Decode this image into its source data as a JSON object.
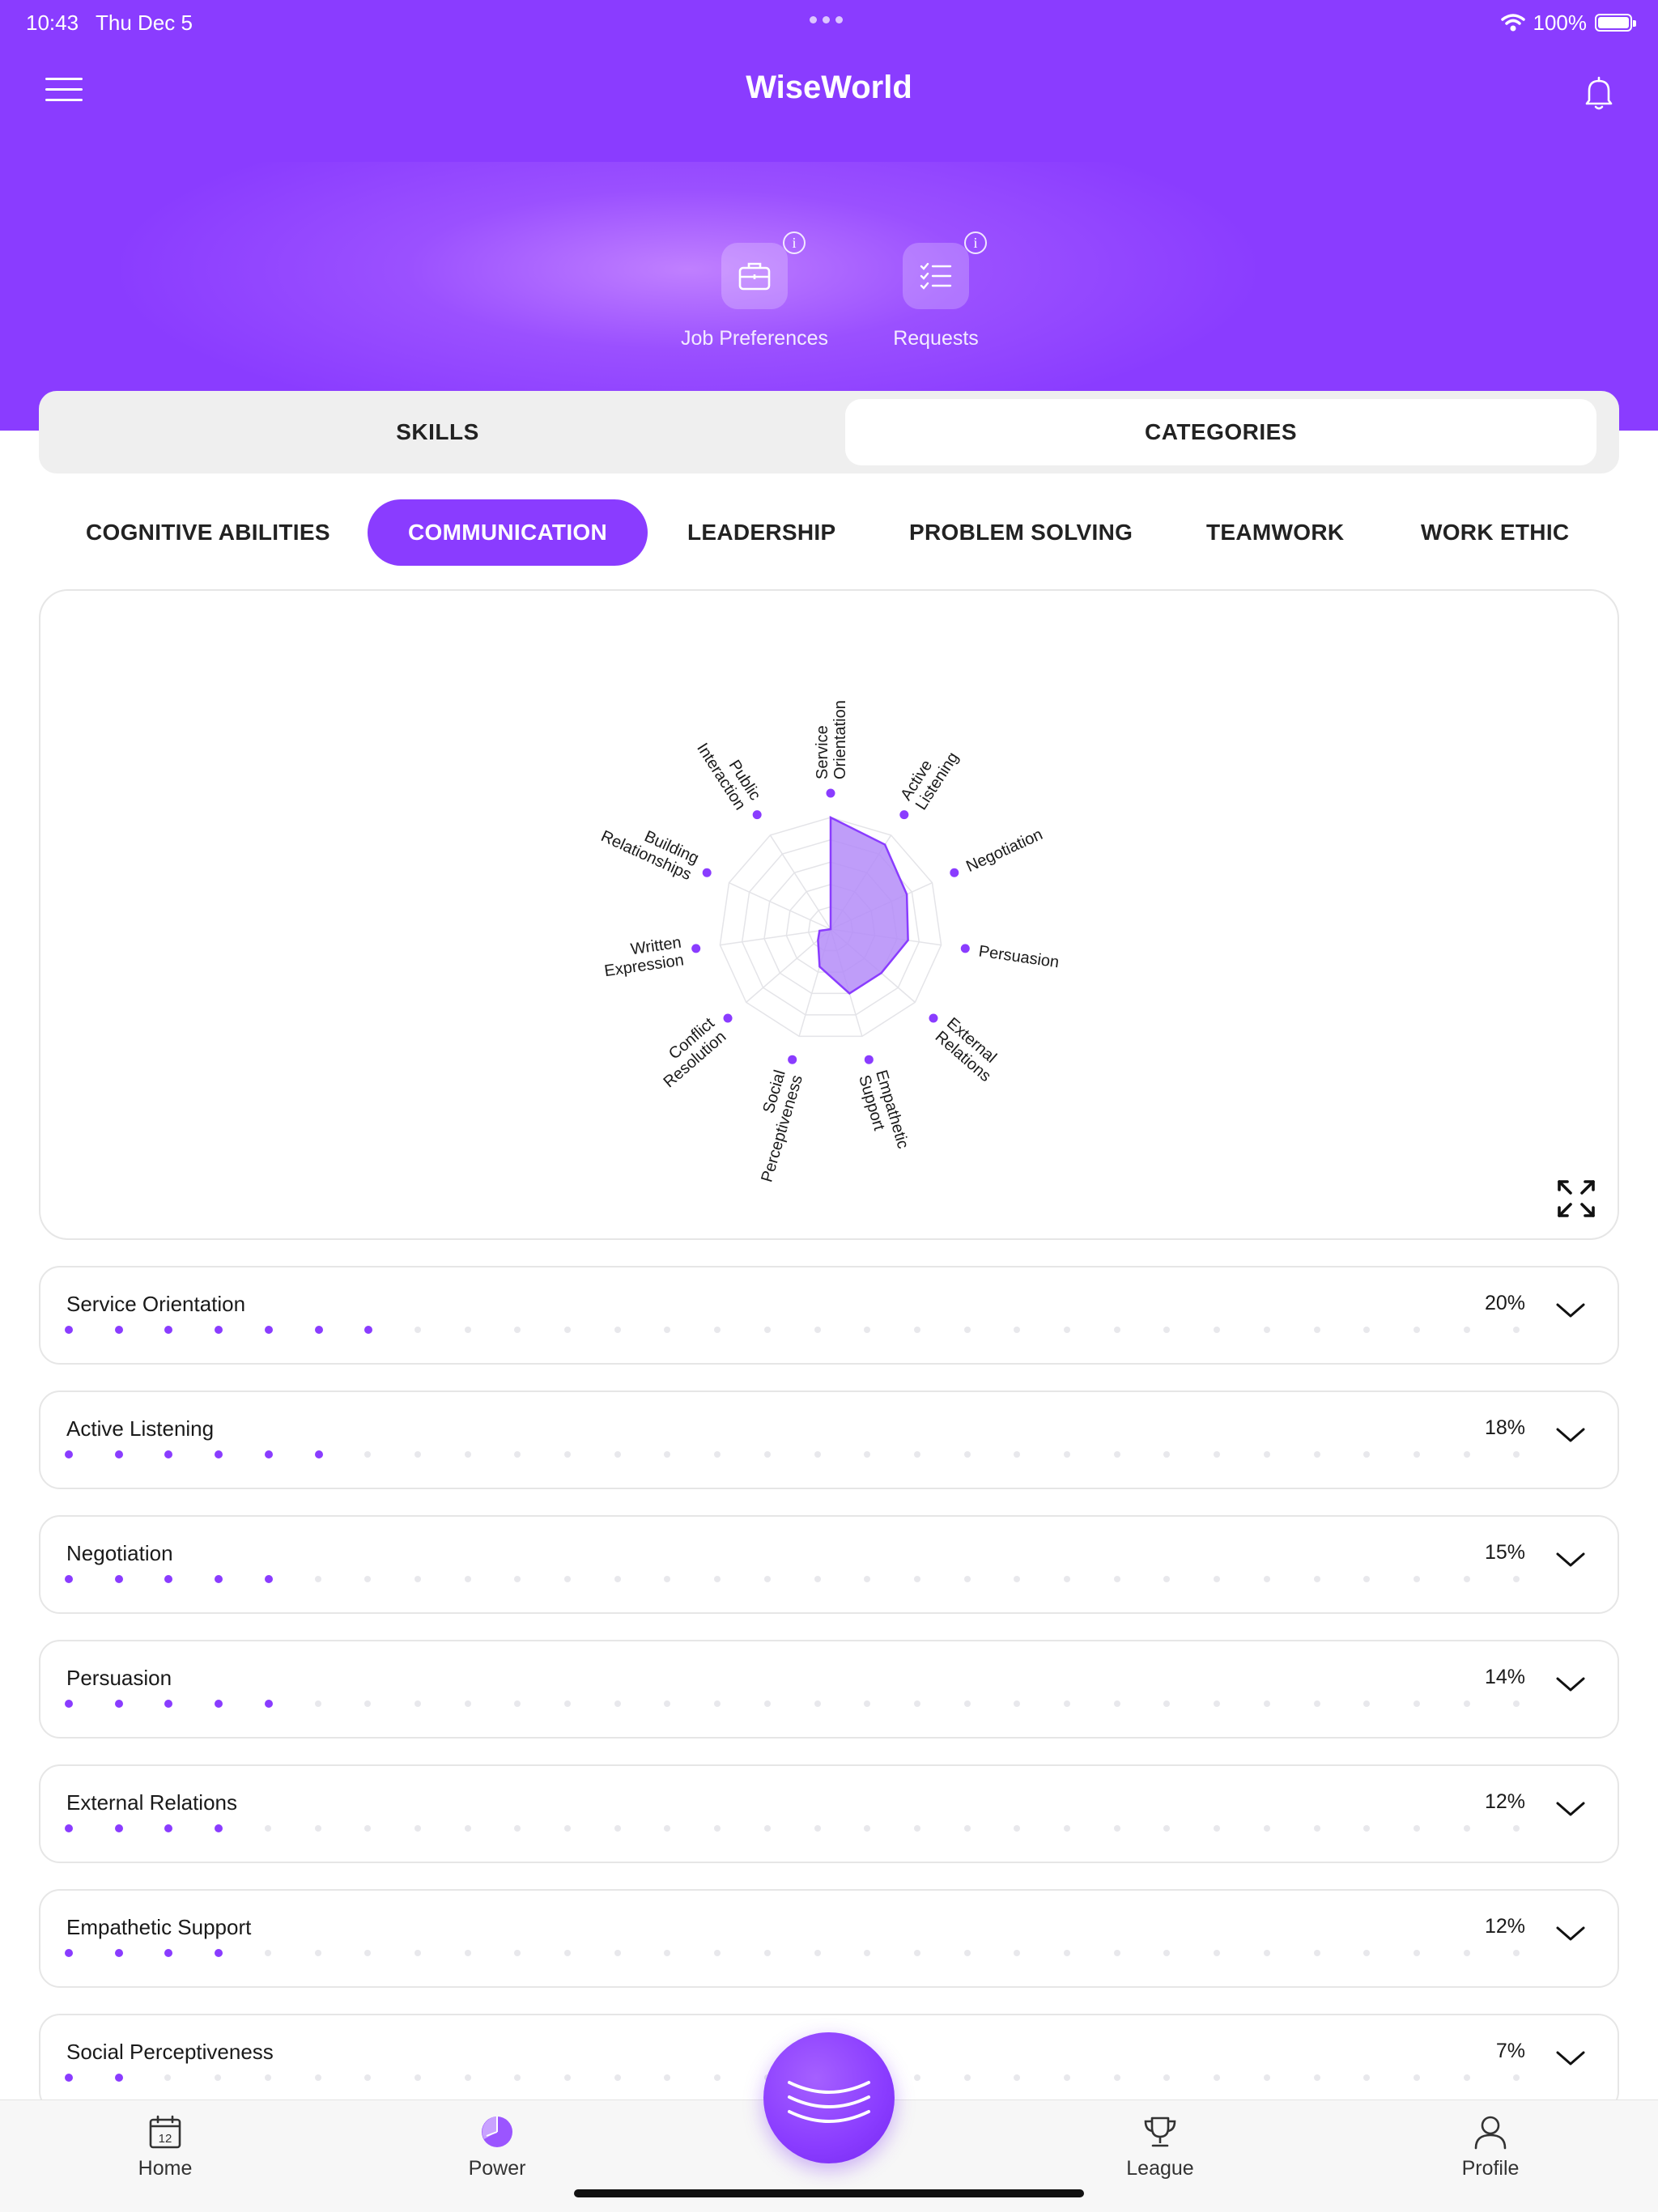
{
  "status_bar": {
    "time": "10:43",
    "date": "Thu Dec 5",
    "battery": "100%"
  },
  "header": {
    "title": "WiseWorld"
  },
  "quick_actions": [
    {
      "label": "Job Preferences",
      "icon": "briefcase-icon"
    },
    {
      "label": "Requests",
      "icon": "checklist-icon"
    }
  ],
  "segment": {
    "tabs": [
      "SKILLS",
      "CATEGORIES"
    ],
    "selected": "CATEGORIES"
  },
  "category_tabs": [
    "COGNITIVE ABILITIES",
    "COMMUNICATION",
    "LEADERSHIP",
    "PROBLEM SOLVING",
    "TEAMWORK",
    "WORK ETHIC"
  ],
  "selected_category": "COMMUNICATION",
  "colors": {
    "accent": "#8a3cff",
    "fill": "#b48cf8"
  },
  "chart_data": {
    "type": "radar",
    "axes": [
      "Service Orientation",
      "Active Listening",
      "Negotiation",
      "Persuasion",
      "External Relations",
      "Empathetic Support",
      "Social Perceptiveness",
      "Conflict Resolution",
      "Written Expression",
      "Building Relationships",
      "Public Interaction"
    ],
    "axis_labels": [
      [
        "Service",
        "Orientation"
      ],
      [
        "Active",
        "Listening"
      ],
      [
        "Negotiation"
      ],
      [
        "Persuasion"
      ],
      [
        "External",
        "Relations"
      ],
      [
        "Empathetic",
        "Support"
      ],
      [
        "Social",
        "Perceptiveness"
      ],
      [
        "Conflict",
        "Resolution"
      ],
      [
        "Written",
        "Expression"
      ],
      [
        "Building",
        "Relationships"
      ],
      [
        "Public",
        "Interaction"
      ]
    ],
    "values": [
      20,
      18,
      15,
      14,
      12,
      12,
      7,
      3,
      2,
      0,
      0
    ],
    "rmax": 20
  },
  "skills": [
    {
      "name": "Service Orientation",
      "percent": "20%",
      "filled": 7
    },
    {
      "name": "Active Listening",
      "percent": "18%",
      "filled": 6
    },
    {
      "name": "Negotiation",
      "percent": "15%",
      "filled": 5
    },
    {
      "name": "Persuasion",
      "percent": "14%",
      "filled": 5
    },
    {
      "name": "External Relations",
      "percent": "12%",
      "filled": 4
    },
    {
      "name": "Empathetic Support",
      "percent": "12%",
      "filled": 4
    },
    {
      "name": "Social Perceptiveness",
      "percent": "7%",
      "filled": 2
    }
  ],
  "bottom_nav": [
    {
      "label": "Home",
      "icon": "calendar-icon",
      "badge": "12"
    },
    {
      "label": "Power",
      "icon": "pie-chart-icon"
    },
    {
      "label": "League",
      "icon": "trophy-icon"
    },
    {
      "label": "Profile",
      "icon": "person-icon"
    }
  ]
}
